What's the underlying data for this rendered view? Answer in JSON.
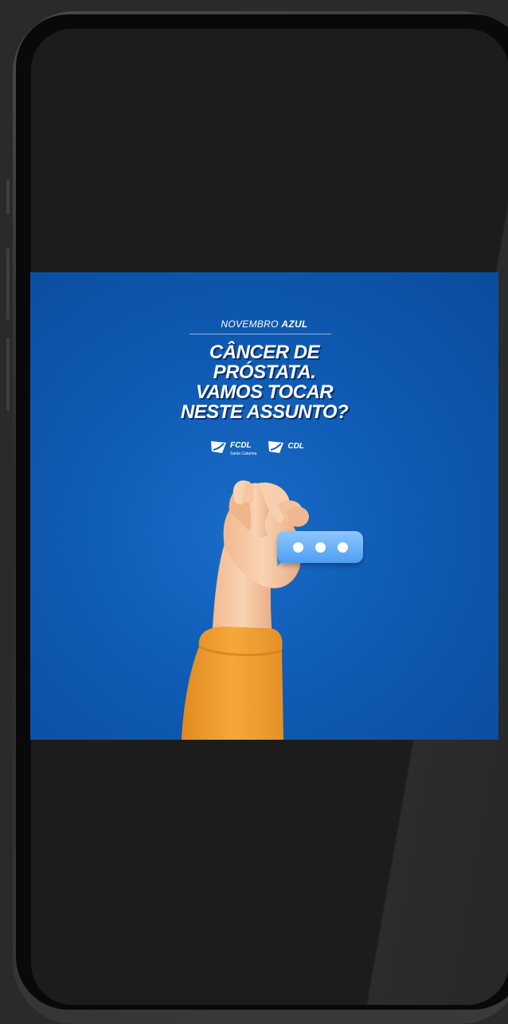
{
  "post": {
    "kicker_light": "NOVEMBRO",
    "kicker_bold": "AZUL",
    "headline_lines": [
      "CÂNCER DE",
      "PRÓSTATA.",
      "VAMOS TOCAR",
      "NESTE ASSUNTO?"
    ],
    "logos": [
      {
        "name": "FCDL",
        "sub": "Santa Catarina"
      },
      {
        "name": "CDL",
        "sub": ""
      }
    ]
  },
  "colors": {
    "post_blue": "#0f5bb4",
    "sleeve_orange": "#f2a334",
    "skin": "#f6c9a4",
    "bubble": "#5aa8f4"
  },
  "icons": [
    "speech-bubble-icon",
    "hand-illustration",
    "fcdl-logo-icon",
    "cdl-logo-icon"
  ]
}
